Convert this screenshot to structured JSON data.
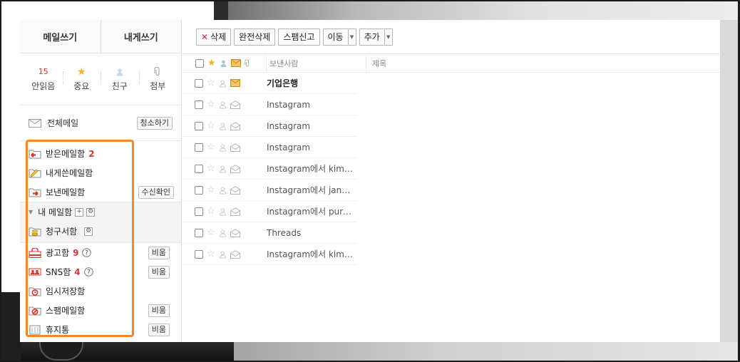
{
  "compose": {
    "write": "메일쓰기",
    "write_self": "내게쓰기"
  },
  "quick": [
    {
      "top": "15",
      "label": "안읽음",
      "icon": "count"
    },
    {
      "top": "★",
      "label": "중요",
      "icon": "star-icon"
    },
    {
      "top": "",
      "label": "친구",
      "icon": "person-icon"
    },
    {
      "top": "",
      "label": "첨부",
      "icon": "paperclip-icon"
    }
  ],
  "all_mail": {
    "label": "전체메일",
    "clean_button": "청소하기"
  },
  "folders": {
    "inbox": {
      "label": "받은메일함",
      "count": "2"
    },
    "to_me": {
      "label": "내게쓴메일함"
    },
    "sent": {
      "label": "보낸메일함",
      "button": "수신확인"
    },
    "my_box": {
      "label": "내 메일함"
    },
    "bills": {
      "label": "청구서함"
    },
    "ads": {
      "label": "광고함",
      "count": "9",
      "button": "비움"
    },
    "sns": {
      "label": "SNS함",
      "count": "4",
      "button": "비움"
    },
    "drafts": {
      "label": "임시저장함"
    },
    "spam": {
      "label": "스팸메일함",
      "button": "비움"
    },
    "trash": {
      "label": "휴지통",
      "button": "비움"
    }
  },
  "toolbar": {
    "delete": "삭제",
    "perm_delete": "완전삭제",
    "report_spam": "스팸신고",
    "move": "이동",
    "add": "추가"
  },
  "list": {
    "columns": {
      "sender": "보낸사람",
      "subject": "제목"
    },
    "rows": [
      {
        "sender": "기업은행",
        "unread": true
      },
      {
        "sender": "Instagram",
        "unread": false
      },
      {
        "sender": "Instagram",
        "unread": false
      },
      {
        "sender": "Instagram",
        "unread": false
      },
      {
        "sender": "Instagram에서 kim_ll...",
        "unread": false
      },
      {
        "sender": "Instagram에서 janek...",
        "unread": false
      },
      {
        "sender": "Instagram에서 pure_l...",
        "unread": false
      },
      {
        "sender": "Threads",
        "unread": false
      },
      {
        "sender": "Instagram에서 kim_b...",
        "unread": false
      }
    ]
  },
  "colors": {
    "accent_red": "#d9342b",
    "highlight": "#f2882c",
    "star": "#f3b322"
  }
}
